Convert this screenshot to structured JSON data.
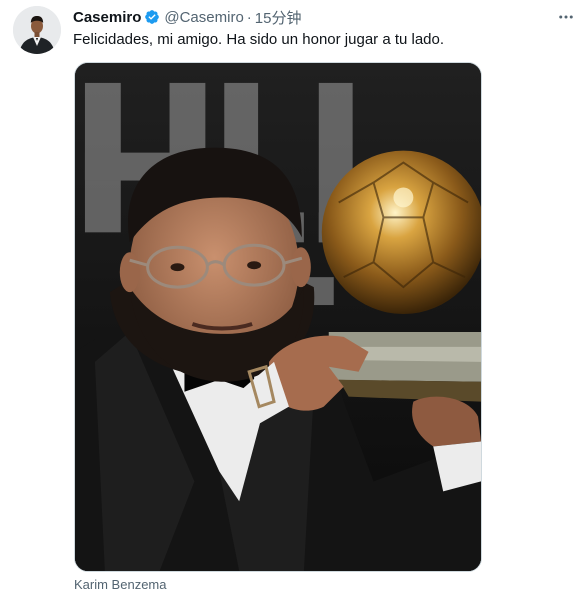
{
  "tweet": {
    "author_name": "Casemiro",
    "author_handle": "@Casemiro",
    "separator": "·",
    "timestamp": "15分钟",
    "text": "Felicidades, mi amigo. Ha sido un honor jugar a tu lado.",
    "media_caption": "Karim Benzema"
  },
  "icons": {
    "verified": "verified-badge-icon",
    "more": "more-options-icon"
  },
  "colors": {
    "verified_blue": "#1d9bf0",
    "secondary_text": "#536471",
    "primary_text": "#0f1419"
  }
}
